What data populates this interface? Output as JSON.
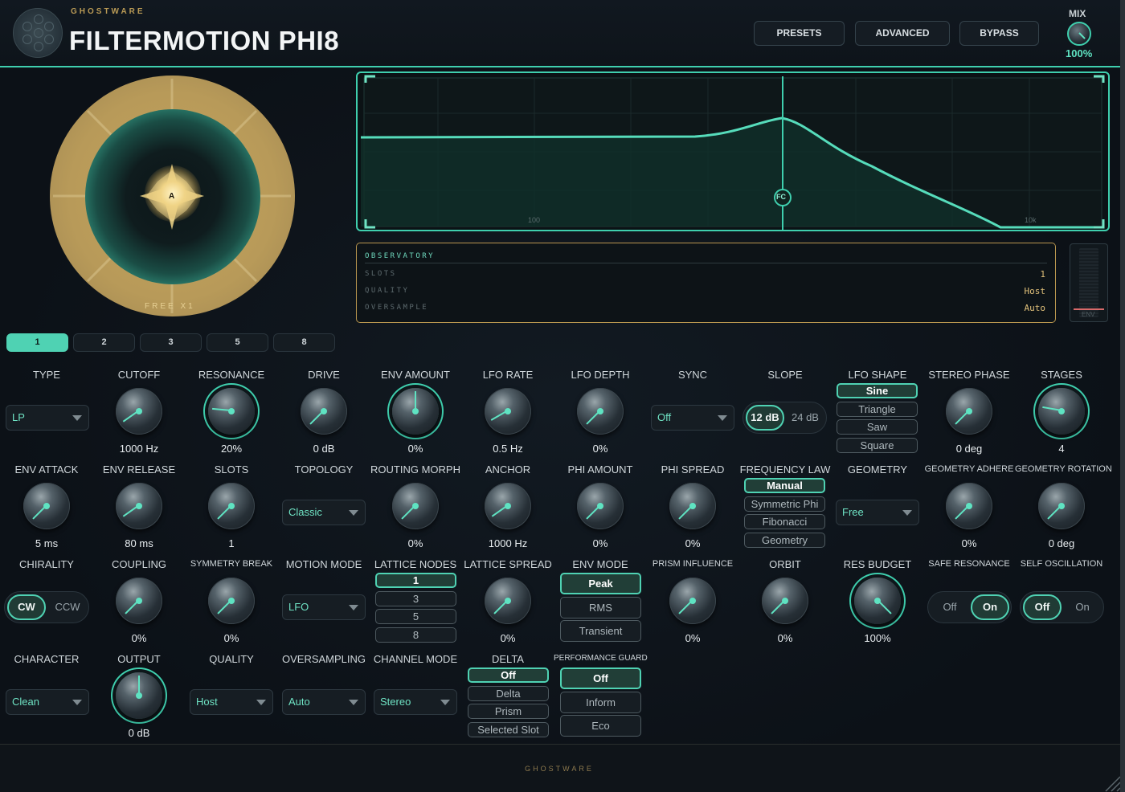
{
  "header": {
    "brand": "GHOSTWARE",
    "title": "FILTERMOTION PHI8",
    "buttons": {
      "presets": "PRESETS",
      "advanced": "ADVANCED",
      "bypass": "BYPASS"
    },
    "mix": {
      "label": "MIX",
      "value": "100%"
    }
  },
  "orb": {
    "center_label": "A",
    "caption": "FREE X1"
  },
  "graph": {
    "ticks": {
      "t100": "100",
      "t10k": "10k"
    },
    "handle_label": "FC"
  },
  "observatory": {
    "title": "OBSERVATORY",
    "rows": [
      {
        "key": "SLOTS",
        "value": "1"
      },
      {
        "key": "QUALITY",
        "value": "Host"
      },
      {
        "key": "OVERSAMPLE",
        "value": "Auto"
      }
    ],
    "meter_label": "ENV"
  },
  "slots": [
    "1",
    "2",
    "3",
    "5",
    "8"
  ],
  "controls": {
    "type": {
      "label": "TYPE",
      "value": "LP"
    },
    "cutoff": {
      "label": "CUTOFF",
      "value": "1000 Hz"
    },
    "resonance": {
      "label": "RESONANCE",
      "value": "20%"
    },
    "drive": {
      "label": "DRIVE",
      "value": "0 dB"
    },
    "env_amount": {
      "label": "ENV AMOUNT",
      "value": "0%"
    },
    "lfo_rate": {
      "label": "LFO RATE",
      "value": "0.5 Hz"
    },
    "lfo_depth": {
      "label": "LFO DEPTH",
      "value": "0%"
    },
    "sync": {
      "label": "SYNC",
      "value": "Off"
    },
    "slope": {
      "label": "SLOPE",
      "options": [
        "12 dB",
        "24 dB"
      ],
      "selected": "12 dB"
    },
    "lfo_shape": {
      "label": "LFO SHAPE",
      "options": [
        "Sine",
        "Triangle",
        "Saw",
        "Square"
      ],
      "selected": "Sine"
    },
    "stereo_phase": {
      "label": "STEREO PHASE",
      "value": "0 deg"
    },
    "stages": {
      "label": "STAGES",
      "value": "4"
    },
    "env_attack": {
      "label": "ENV ATTACK",
      "value": "5 ms"
    },
    "env_release": {
      "label": "ENV RELEASE",
      "value": "80 ms"
    },
    "slots_knob": {
      "label": "SLOTS",
      "value": "1"
    },
    "topology": {
      "label": "TOPOLOGY",
      "value": "Classic"
    },
    "routing_morph": {
      "label": "ROUTING MORPH",
      "value": "0%"
    },
    "anchor": {
      "label": "ANCHOR",
      "value": "1000 Hz"
    },
    "phi_amount": {
      "label": "PHI AMOUNT",
      "value": "0%"
    },
    "phi_spread": {
      "label": "PHI SPREAD",
      "value": "0%"
    },
    "frequency_law": {
      "label": "FREQUENCY LAW",
      "options": [
        "Manual",
        "Symmetric Phi",
        "Fibonacci",
        "Geometry"
      ],
      "selected": "Manual"
    },
    "geometry": {
      "label": "GEOMETRY",
      "value": "Free"
    },
    "geometry_adhere": {
      "label": "GEOMETRY ADHERE",
      "value": "0%"
    },
    "geometry_rotation": {
      "label": "GEOMETRY ROTATION",
      "value": "0 deg"
    },
    "chirality": {
      "label": "CHIRALITY",
      "options": [
        "CW",
        "CCW"
      ],
      "selected": "CW"
    },
    "coupling": {
      "label": "COUPLING",
      "value": "0%"
    },
    "symmetry_break": {
      "label": "SYMMETRY BREAK",
      "value": "0%"
    },
    "motion_mode": {
      "label": "MOTION MODE",
      "value": "LFO"
    },
    "lattice_nodes": {
      "label": "LATTICE NODES",
      "options": [
        "1",
        "3",
        "5",
        "8"
      ],
      "selected": "1"
    },
    "lattice_spread": {
      "label": "LATTICE SPREAD",
      "value": "0%"
    },
    "env_mode": {
      "label": "ENV MODE",
      "options": [
        "Peak",
        "RMS",
        "Transient"
      ],
      "selected": "Peak"
    },
    "prism_influence": {
      "label": "PRISM INFLUENCE",
      "value": "0%"
    },
    "orbit": {
      "label": "ORBIT",
      "value": "0%"
    },
    "res_budget": {
      "label": "RES BUDGET",
      "value": "100%"
    },
    "safe_resonance": {
      "label": "SAFE RESONANCE",
      "options": [
        "Off",
        "On"
      ],
      "selected": "On"
    },
    "self_oscillation": {
      "label": "SELF OSCILLATION",
      "options": [
        "Off",
        "On"
      ],
      "selected": "Off"
    },
    "character": {
      "label": "CHARACTER",
      "value": "Clean"
    },
    "output": {
      "label": "OUTPUT",
      "value": "0 dB"
    },
    "quality": {
      "label": "QUALITY",
      "value": "Host"
    },
    "oversampling": {
      "label": "OVERSAMPLING",
      "value": "Auto"
    },
    "channel_mode": {
      "label": "CHANNEL MODE",
      "value": "Stereo"
    },
    "delta": {
      "label": "DELTA",
      "options": [
        "Off",
        "Delta",
        "Prism",
        "Selected Slot"
      ],
      "selected": "Off"
    },
    "performance_guard": {
      "label": "PERFORMANCE GUARD",
      "options": [
        "Off",
        "Inform",
        "Eco"
      ],
      "selected": "Off"
    }
  },
  "footer": {
    "brand": "GHOSTWARE"
  },
  "colors": {
    "accent": "#4fd2b3",
    "gold": "#b99a55",
    "background": "#0d1218"
  }
}
